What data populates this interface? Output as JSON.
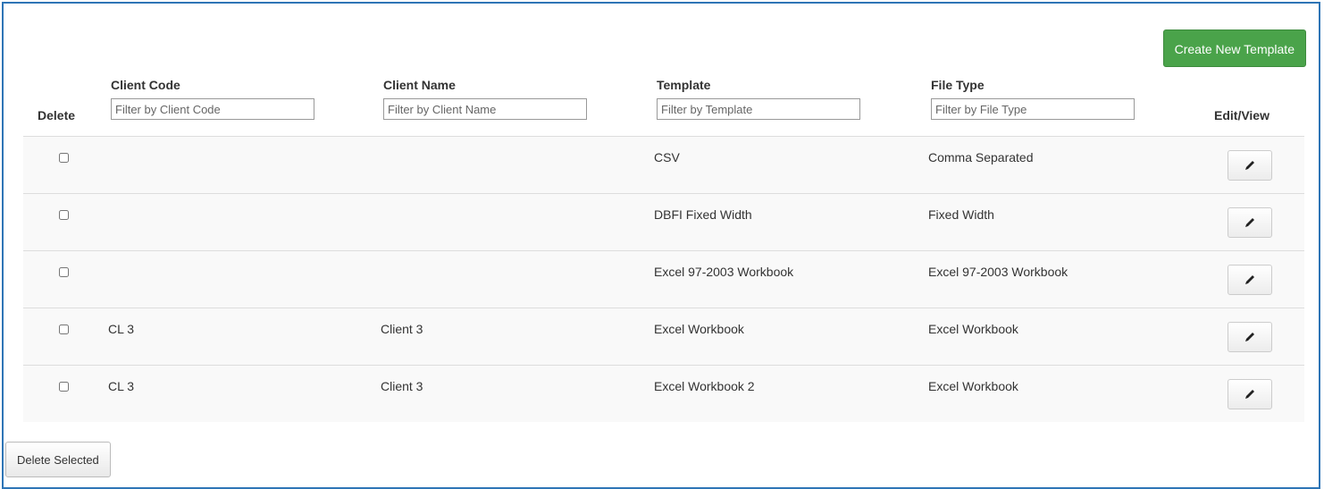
{
  "toolbar": {
    "create_label": "Create New Template",
    "delete_selected_label": "Delete Selected"
  },
  "table": {
    "headers": {
      "delete": "Delete",
      "client_code": "Client Code",
      "client_name": "Client Name",
      "template": "Template",
      "file_type": "File Type",
      "edit_view": "Edit/View"
    },
    "filters": {
      "client_code": "Filter by Client Code",
      "client_name": "Filter by Client Name",
      "template": "Filter by Template",
      "file_type": "Filter by File Type"
    },
    "rows": [
      {
        "client_code": "",
        "client_name": "",
        "template": "CSV",
        "file_type": "Comma Separated"
      },
      {
        "client_code": "",
        "client_name": "",
        "template": "DBFI Fixed Width",
        "file_type": "Fixed Width"
      },
      {
        "client_code": "",
        "client_name": "",
        "template": "Excel 97-2003 Workbook",
        "file_type": "Excel 97-2003 Workbook"
      },
      {
        "client_code": "CL 3",
        "client_name": "Client 3",
        "template": "Excel Workbook",
        "file_type": "Excel Workbook"
      },
      {
        "client_code": "CL 3",
        "client_name": "Client 3",
        "template": "Excel Workbook 2",
        "file_type": "Excel Workbook"
      }
    ]
  },
  "icons": {
    "edit": "pencil-icon"
  },
  "colors": {
    "border": "#2e75b6",
    "create_button": "#4aa34a",
    "row_background": "#f9f9f9"
  }
}
